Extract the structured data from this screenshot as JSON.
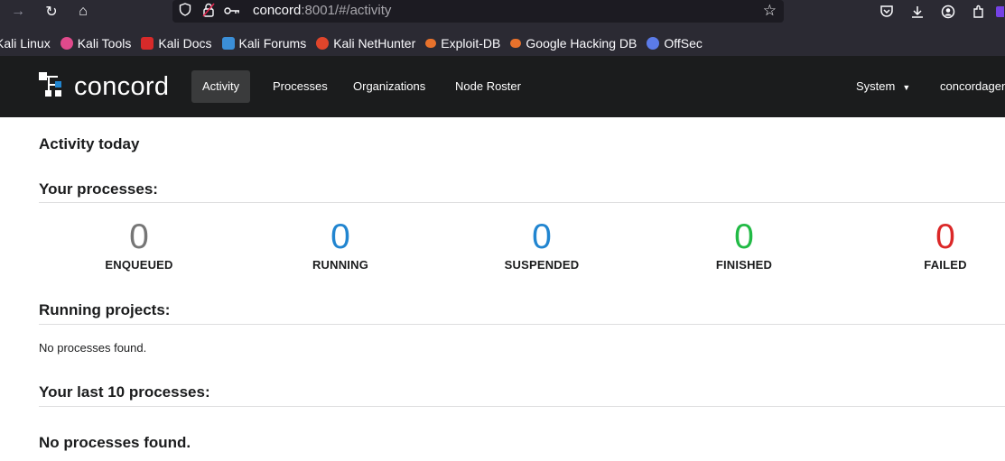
{
  "browser": {
    "url_host": "concord",
    "url_rest": ":8001/#/activity",
    "bookmarks": [
      {
        "label": "Kali Linux",
        "color": "#367bf0"
      },
      {
        "label": "Kali Tools",
        "color": "#e04a8c"
      },
      {
        "label": "Kali Docs",
        "color": "#d72a2a"
      },
      {
        "label": "Kali Forums",
        "color": "#3b8fd8"
      },
      {
        "label": "Kali NetHunter",
        "color": "#e0452b"
      },
      {
        "label": "Exploit-DB",
        "color": "#e8722c"
      },
      {
        "label": "Google Hacking DB",
        "color": "#e8722c"
      },
      {
        "label": "OffSec",
        "color": "#5b7be8"
      }
    ]
  },
  "app": {
    "logo_text": "concord",
    "nav": {
      "activity": "Activity",
      "processes": "Processes",
      "organizations": "Organizations",
      "node_roster": "Node Roster",
      "system": "System",
      "user": "concordagent"
    }
  },
  "page": {
    "title": "Activity today",
    "your_processes": "Your processes:",
    "stats": [
      {
        "label": "ENQUEUED",
        "value": "0",
        "color": "#767676"
      },
      {
        "label": "RUNNING",
        "value": "0",
        "color": "#2185d0"
      },
      {
        "label": "SUSPENDED",
        "value": "0",
        "color": "#2185d0"
      },
      {
        "label": "FINISHED",
        "value": "0",
        "color": "#21ba45"
      },
      {
        "label": "FAILED",
        "value": "0",
        "color": "#db2828"
      }
    ],
    "running_projects": "Running projects:",
    "running_empty": "No processes found.",
    "last_processes": "Your last 10 processes:",
    "last_empty": "No processes found."
  },
  "colors": {
    "browser_bg": "#2b2a33",
    "navbar_bg": "#1b1c1d",
    "active_nav_bg": "#3a3b3c"
  }
}
